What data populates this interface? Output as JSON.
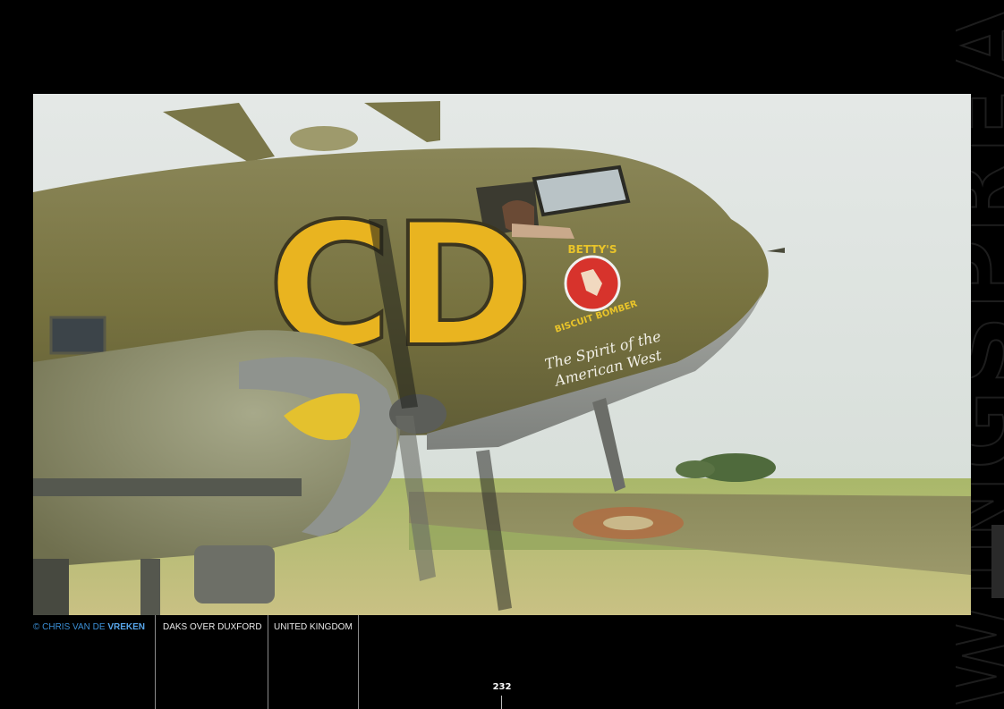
{
  "photo": {
    "fuselage_code": "CD",
    "nose_art": {
      "name_top": "BETTY'S",
      "name_bottom": "BISCUIT BOMBER",
      "script_line1": "The Spirit of the",
      "script_line2": "American West"
    }
  },
  "caption": {
    "credit_prefix": "© CHRIS VAN DE ",
    "credit_surname": "VREKEN",
    "title": "DAKS OVER DUXFORD",
    "location": "UNITED KINGDOM"
  },
  "page": {
    "number": "232"
  },
  "colors": {
    "background": "#000000",
    "olive_drab": "#7f7a48",
    "code_yellow": "#e9b420",
    "credit_blue": "#3b8fd6"
  }
}
